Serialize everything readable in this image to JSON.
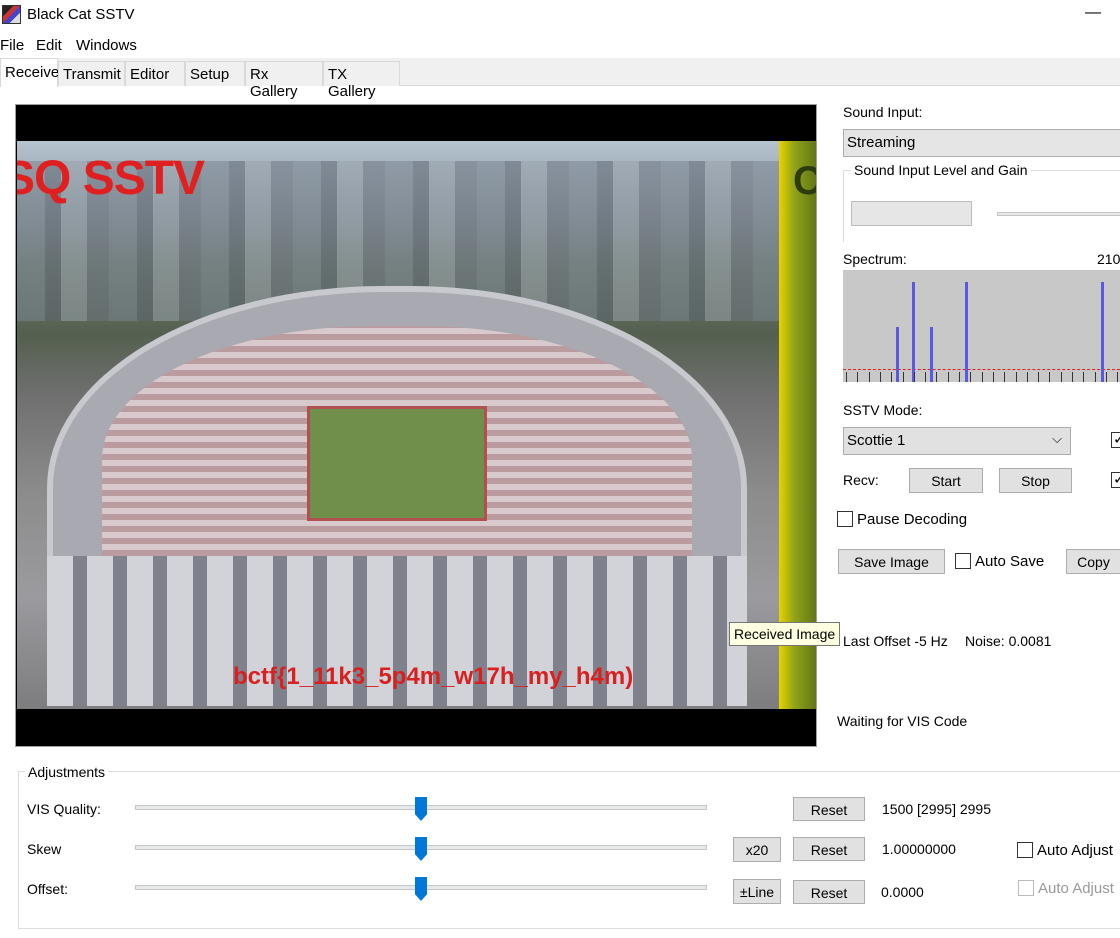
{
  "window": {
    "title": "Black Cat SSTV",
    "minimize_glyph": "—"
  },
  "menu": {
    "items": [
      "File",
      "Edit",
      "Windows"
    ]
  },
  "tabs": {
    "items": [
      "Receive",
      "Transmit",
      "Editor",
      "Setup",
      "Rx Gallery",
      "TX Gallery"
    ],
    "active": "Receive"
  },
  "image": {
    "overlay_title": "SQ SSTV",
    "overlay_text": "bctf{1_11k3_5p4m_w17h_my_h4m)",
    "right_strip_text": "C",
    "tooltip": "Received Image"
  },
  "sound": {
    "input_label": "Sound Input:",
    "input_value": "Streaming",
    "level_group_title": "Sound Input Level and Gain"
  },
  "spectrum": {
    "label": "Spectrum:",
    "scale_value": "210",
    "bars": [
      {
        "position": 0.19,
        "height": 0.55
      },
      {
        "position": 0.25,
        "height": 1.0
      },
      {
        "position": 0.315,
        "height": 0.55
      },
      {
        "position": 0.44,
        "height": 1.0
      },
      {
        "position": 0.93,
        "height": 1.0
      }
    ],
    "colors": {
      "background": "#c8c8c8",
      "bar": "#5a5ae0",
      "baseline": "#dd2222"
    }
  },
  "sstv_mode": {
    "label": "SSTV Mode:",
    "value": "Scottie 1"
  },
  "recv": {
    "label": "Recv:",
    "start_label": "Start",
    "stop_label": "Stop"
  },
  "pause": {
    "label": "Pause Decoding",
    "checked": false
  },
  "save": {
    "button_label": "Save Image",
    "auto_save_label": "Auto Save",
    "copy_label": "Copy"
  },
  "status": {
    "last_offset": "Last Offset -5 Hz",
    "noise": "Noise: 0.0081",
    "waiting": "Waiting for VIS Code"
  },
  "adjustments": {
    "title": "Adjustments",
    "rows": [
      {
        "label": "VIS Quality:",
        "extra_button": "",
        "reset_label": "Reset",
        "value": "1500 [2995] 2995",
        "slider_fraction": 0.5
      },
      {
        "label": "Skew",
        "extra_button": "x20",
        "reset_label": "Reset",
        "value": "1.00000000",
        "slider_fraction": 0.5
      },
      {
        "label": "Offset:",
        "extra_button": "±Line",
        "reset_label": "Reset",
        "value": "0.0000",
        "slider_fraction": 0.5
      }
    ],
    "auto_adjust_label": "Auto Adjust",
    "auto_adjust_label_2": "Auto Adjust"
  }
}
